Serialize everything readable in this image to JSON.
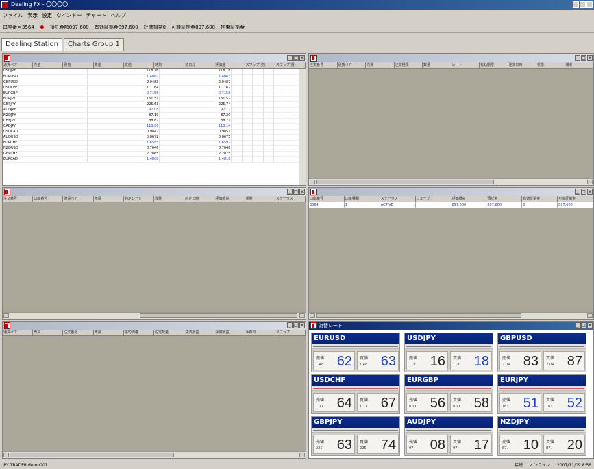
{
  "window": {
    "title": "Dealing FX - 〇〇〇〇"
  },
  "menu": [
    "ファイル",
    "表示",
    "設定",
    "ウインドー",
    "チャート",
    "ヘルプ"
  ],
  "status": {
    "account": "口座番号3564",
    "items": [
      "預託金額897,600",
      "有効証拠金897,600",
      "評価損益0",
      "可能証拠金897,600",
      "拘束証拠金"
    ]
  },
  "tabs": {
    "dealing": "Dealing Station",
    "charts": "Charts Group 1"
  },
  "panels": {
    "rates_table": {
      "columns": [
        "通貨ペア",
        "売値",
        "買値",
        "高値",
        "安値",
        "時刻",
        "前日比",
        "評価益",
        "スワップ(売)",
        "スワップ(買)"
      ],
      "rows": [
        [
          "USDJPY",
          "118.16",
          "118.18",
          "",
          "",
          "",
          "",
          "",
          "",
          ""
        ],
        [
          "EURUSD",
          "1.4862",
          "1.4863",
          "",
          "",
          "",
          "",
          "",
          "",
          ""
        ],
        [
          "GBPUSD",
          "2.0483",
          "2.0487",
          "",
          "",
          "",
          "",
          "",
          "",
          ""
        ],
        [
          "USDCHF",
          "1.1164",
          "1.1167",
          "",
          "",
          "",
          "",
          "",
          "",
          ""
        ],
        [
          "EURGBP",
          "0.7156",
          "0.7158",
          "",
          "",
          "",
          "",
          "",
          "",
          ""
        ],
        [
          "EURJPY",
          "161.51",
          "161.52",
          "",
          "",
          "",
          "",
          "",
          "",
          ""
        ],
        [
          "GBPJPY",
          "225.63",
          "225.74",
          "",
          "",
          "",
          "",
          "",
          "",
          ""
        ],
        [
          "AUDJPY",
          "97.08",
          "97.17",
          "",
          "",
          "",
          "",
          "",
          "",
          ""
        ],
        [
          "NZDJPY",
          "87.10",
          "87.20",
          "",
          "",
          "",
          "",
          "",
          "",
          ""
        ],
        [
          "CHFJPY",
          "88.82",
          "88.71",
          "",
          "",
          "",
          "",
          "",
          "",
          ""
        ],
        [
          "CADJPY",
          "113.06",
          "113.14",
          "",
          "",
          "",
          "",
          "",
          "",
          ""
        ],
        [
          "USDCAD",
          "0.9847",
          "0.9851",
          "",
          "",
          "",
          "",
          "",
          "",
          ""
        ],
        [
          "AUDUSD",
          "0.8672",
          "0.8675",
          "",
          "",
          "",
          "",
          "",
          "",
          ""
        ],
        [
          "EURCHF",
          "1.6585",
          "1.6592",
          "",
          "",
          "",
          "",
          "",
          "",
          ""
        ],
        [
          "NZDUSD",
          "0.7646",
          "0.7648",
          "",
          "",
          "",
          "",
          "",
          "",
          ""
        ],
        [
          "GBPCHF",
          "2.2865",
          "2.2875",
          "",
          "",
          "",
          "",
          "",
          "",
          ""
        ],
        [
          "EURCAD",
          "1.4808",
          "1.4818",
          "",
          "",
          "",
          "",
          "",
          "",
          ""
        ]
      ]
    },
    "orders": {
      "columns": [
        "注文番号",
        "通貨ペア",
        "売買",
        "注文種類",
        "数量",
        "レート",
        "有効期限",
        "注文日時",
        "状態",
        "備考"
      ]
    },
    "trades": {
      "columns": [
        "注文番号",
        "口座番号",
        "通貨ペア",
        "売買",
        "約定レート",
        "数量",
        "約定日時",
        "評価損益",
        "状態",
        "ステータス"
      ]
    },
    "positions": {
      "columns": [
        "口座番号",
        "口座種類",
        "ステータス",
        "ウェーブ",
        "評価損益",
        "預託金",
        "有効証拠金",
        "可能証拠金"
      ],
      "row": [
        "3564",
        "1",
        "ACTIVE",
        "",
        "897,600",
        "897,600",
        "0",
        "897,600"
      ]
    },
    "history": {
      "columns": [
        "通貨ペア",
        "売買",
        "注文番号",
        "売買",
        "平均価格",
        "約定数量",
        "決済損益",
        "評価損益",
        "手数料",
        "スワップ"
      ]
    },
    "rate_panel": {
      "title": "為替レート",
      "bid_label": "売値",
      "ask_label": "買値",
      "tiles": [
        {
          "pair": "EURUSD",
          "bid_pre": "1.48",
          "bid_big": "62",
          "ask_pre": "1.48",
          "ask_big": "63",
          "bid_up": true,
          "ask_up": true
        },
        {
          "pair": "USDJPY",
          "bid_pre": "118.",
          "bid_big": "16",
          "ask_pre": "118.",
          "ask_big": "18",
          "bid_up": false,
          "ask_up": true
        },
        {
          "pair": "GBPUSD",
          "bid_pre": "2.04",
          "bid_big": "83",
          "ask_pre": "2.04",
          "ask_big": "87",
          "bid_up": false,
          "ask_up": false
        },
        {
          "pair": "USDCHF",
          "bid_pre": "1.11",
          "bid_big": "64",
          "ask_pre": "1.11",
          "ask_big": "67",
          "bid_up": false,
          "ask_up": false
        },
        {
          "pair": "EURGBP",
          "bid_pre": "0.71",
          "bid_big": "56",
          "ask_pre": "0.71",
          "ask_big": "58",
          "bid_up": false,
          "ask_up": false
        },
        {
          "pair": "EURJPY",
          "bid_pre": "161.",
          "bid_big": "51",
          "ask_pre": "161.",
          "ask_big": "52",
          "bid_up": true,
          "ask_up": true
        },
        {
          "pair": "GBPJPY",
          "bid_pre": "225.",
          "bid_big": "63",
          "ask_pre": "225.",
          "ask_big": "74",
          "bid_up": false,
          "ask_up": false
        },
        {
          "pair": "AUDJPY",
          "bid_pre": "97.",
          "bid_big": "08",
          "ask_pre": "97.",
          "ask_big": "17",
          "bid_up": false,
          "ask_up": false
        },
        {
          "pair": "NZDJPY",
          "bid_pre": "87.",
          "bid_big": "10",
          "ask_pre": "87.",
          "ask_big": "20",
          "bid_up": false,
          "ask_up": false
        }
      ]
    }
  },
  "footer": {
    "left": "JPY  TRADER demo001",
    "right": [
      "接続",
      "オンライン",
      "2007/11/09 8:56"
    ]
  },
  "colors": {
    "tile_header": "#0b2d8f",
    "up": "#1e3fd2",
    "down": "#d02020",
    "title_active": "#0a246a"
  }
}
